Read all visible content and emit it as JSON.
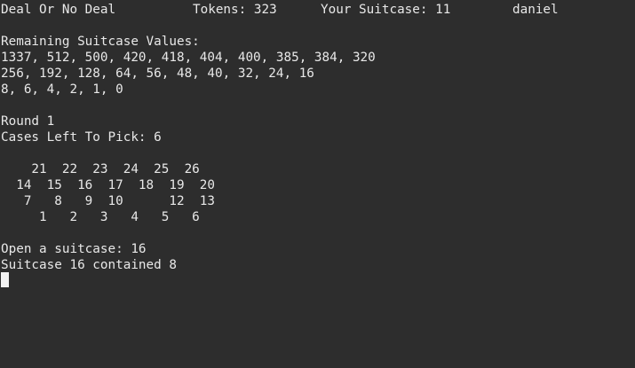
{
  "header": {
    "title": "Deal Or No Deal",
    "tokens": "Tokens: 323",
    "suitcase": "Your Suitcase: 11",
    "player": "daniel"
  },
  "remaining_values": {
    "label": "Remaining Suitcase Values:",
    "rows": [
      "1337, 512, 500, 420, 418, 404, 400, 385, 384, 320",
      "256, 192, 128, 64, 56, 48, 40, 32, 24, 16",
      "8, 6, 4, 2, 1, 0"
    ]
  },
  "round": {
    "label": "Round 1",
    "cases_left": "Cases Left To Pick: 6"
  },
  "suitcase_grid": {
    "rows": [
      "    21  22  23  24  25  26",
      "  14  15  16  17  18  19  20",
      "   7   8   9  10      12  13",
      "     1   2   3   4   5   6"
    ]
  },
  "transcript": {
    "prompt": "Open a suitcase: 16",
    "result": "Suitcase 16 contained 8"
  },
  "terminal": {
    "background": "#2d2d2d",
    "foreground": "#e8e8e8",
    "cursor_color": "#f2f2f2"
  }
}
